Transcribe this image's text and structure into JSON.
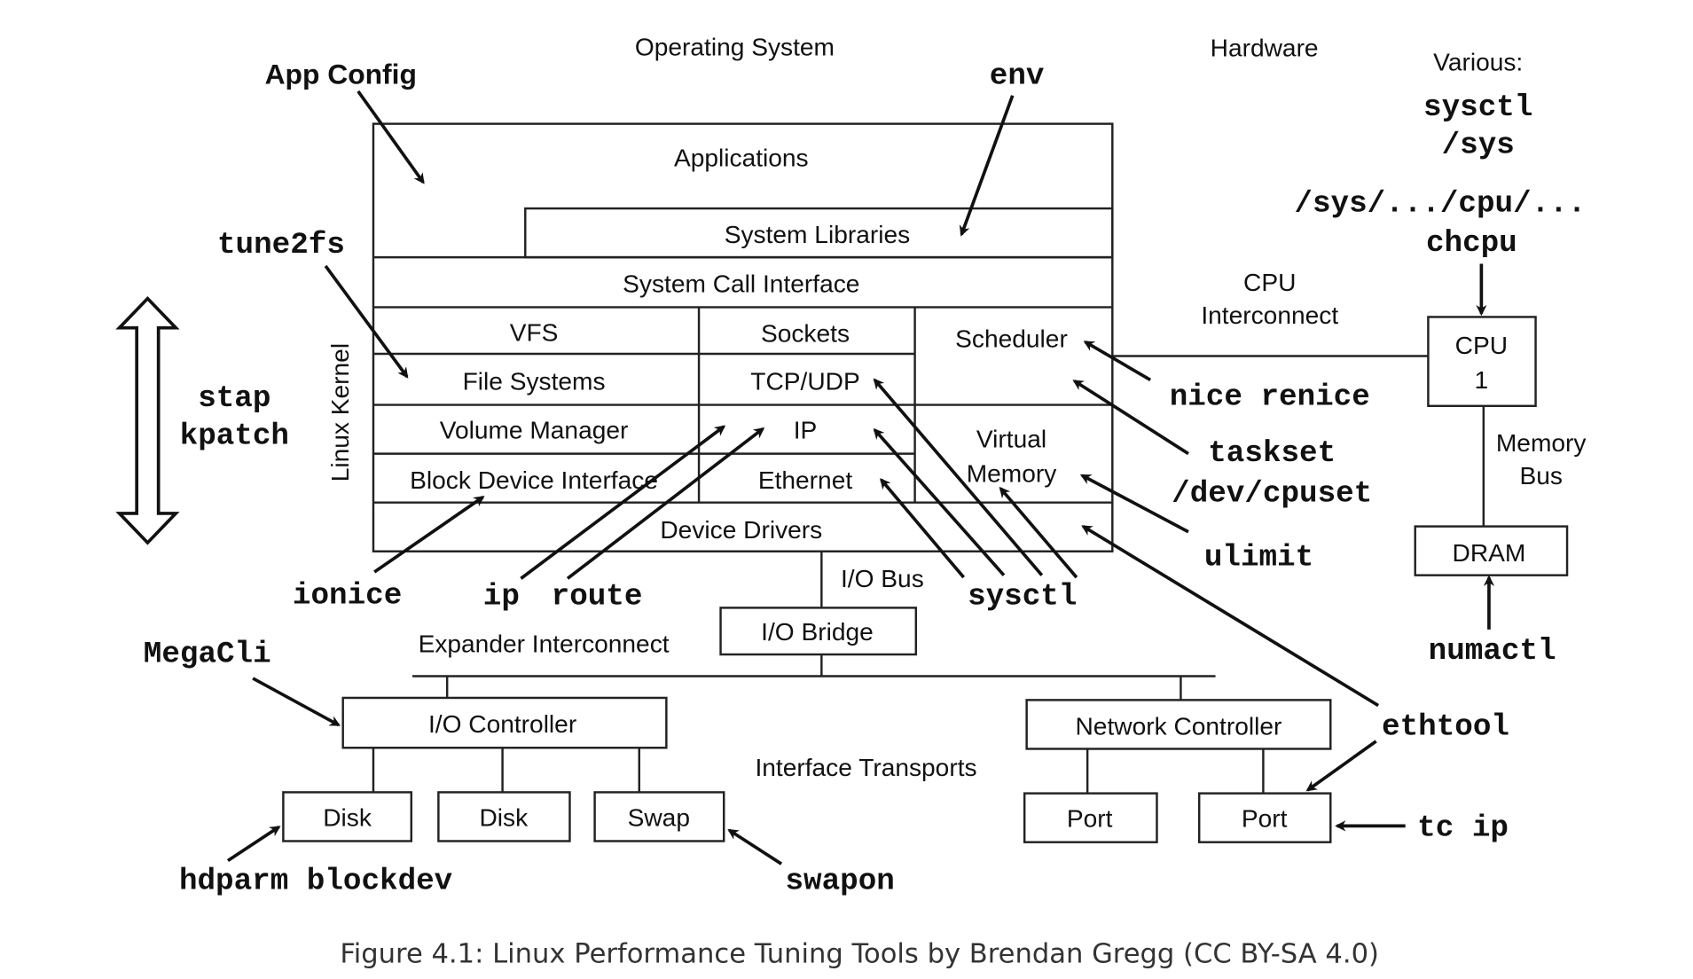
{
  "headers": {
    "operating_system": "Operating System",
    "hardware": "Hardware",
    "various": "Various:"
  },
  "various_tools": {
    "sysctl": "sysctl",
    "sys": "/sys",
    "sys_cpu": "/sys/.../cpu/...",
    "chcpu": "chcpu"
  },
  "os_stack": {
    "applications": "Applications",
    "system_libraries": "System Libraries",
    "system_call_interface": "System Call Interface",
    "vfs": "VFS",
    "sockets": "Sockets",
    "scheduler": "Scheduler",
    "file_systems": "File Systems",
    "tcp_udp": "TCP/UDP",
    "volume_manager": "Volume Manager",
    "ip": "IP",
    "virtual": "Virtual",
    "memory": "Memory",
    "block_device_interface": "Block Device Interface",
    "ethernet": "Ethernet",
    "device_drivers": "Device Drivers",
    "linux_kernel": "Linux Kernel"
  },
  "hardware": {
    "cpu": "CPU",
    "cpu_num": "1",
    "cpu_interconnect_1": "CPU",
    "cpu_interconnect_2": "Interconnect",
    "memory_bus_1": "Memory",
    "memory_bus_2": "Bus",
    "dram": "DRAM",
    "io_bus": "I/O Bus",
    "io_bridge": "I/O Bridge",
    "expander_interconnect": "Expander Interconnect",
    "io_controller": "I/O Controller",
    "network_controller": "Network Controller",
    "interface_transports": "Interface Transports",
    "disk1": "Disk",
    "disk2": "Disk",
    "swap": "Swap",
    "port1": "Port",
    "port2": "Port"
  },
  "tools": {
    "app_config": "App Config",
    "env": "env",
    "tune2fs": "tune2fs",
    "stap": "stap",
    "kpatch": "kpatch",
    "nice_renice": "nice renice",
    "taskset": "taskset",
    "dev_cpuset": "/dev/cpuset",
    "ulimit": "ulimit",
    "ionice": "ionice",
    "ip": "ip",
    "route": "route",
    "sysctl": "sysctl",
    "numactl": "numactl",
    "megacli": "MegaCli",
    "ethtool": "ethtool",
    "tc_ip": "tc ip",
    "hdparm_blockdev": "hdparm blockdev",
    "swapon": "swapon"
  },
  "caption": "Figure 4.1: Linux Performance Tuning Tools by Brendan Gregg (CC BY-SA 4.0)"
}
